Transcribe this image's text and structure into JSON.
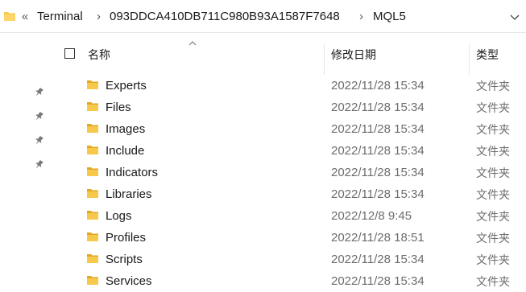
{
  "address_bar": {
    "overflow_glyph": "«",
    "segments": [
      "Terminal",
      "093DDCA410DB711C980B93A1587F7648",
      "MQL5"
    ],
    "separator_glyph": "›",
    "folder_icon": "folder-icon",
    "dropdown_icon": "chevron-down-icon"
  },
  "quick_access": {
    "pin_icon": "pin-icon",
    "pin_count": 4
  },
  "columns": {
    "name": "名称",
    "date_modified": "修改日期",
    "type": "类型"
  },
  "rows": [
    {
      "name": "Experts",
      "date": "2022/11/28 15:34",
      "type": "文件夹"
    },
    {
      "name": "Files",
      "date": "2022/11/28 15:34",
      "type": "文件夹"
    },
    {
      "name": "Images",
      "date": "2022/11/28 15:34",
      "type": "文件夹"
    },
    {
      "name": "Include",
      "date": "2022/11/28 15:34",
      "type": "文件夹"
    },
    {
      "name": "Indicators",
      "date": "2022/11/28 15:34",
      "type": "文件夹"
    },
    {
      "name": "Libraries",
      "date": "2022/11/28 15:34",
      "type": "文件夹"
    },
    {
      "name": "Logs",
      "date": "2022/12/8 9:45",
      "type": "文件夹"
    },
    {
      "name": "Profiles",
      "date": "2022/11/28 18:51",
      "type": "文件夹"
    },
    {
      "name": "Scripts",
      "date": "2022/11/28 15:34",
      "type": "文件夹"
    },
    {
      "name": "Services",
      "date": "2022/11/28 15:34",
      "type": "文件夹"
    }
  ],
  "colors": {
    "folder_yellow": "#f8c84a",
    "folder_dark": "#e2a81f",
    "secondary_text": "#6d6d6d",
    "separator": "#e5e5e5"
  }
}
